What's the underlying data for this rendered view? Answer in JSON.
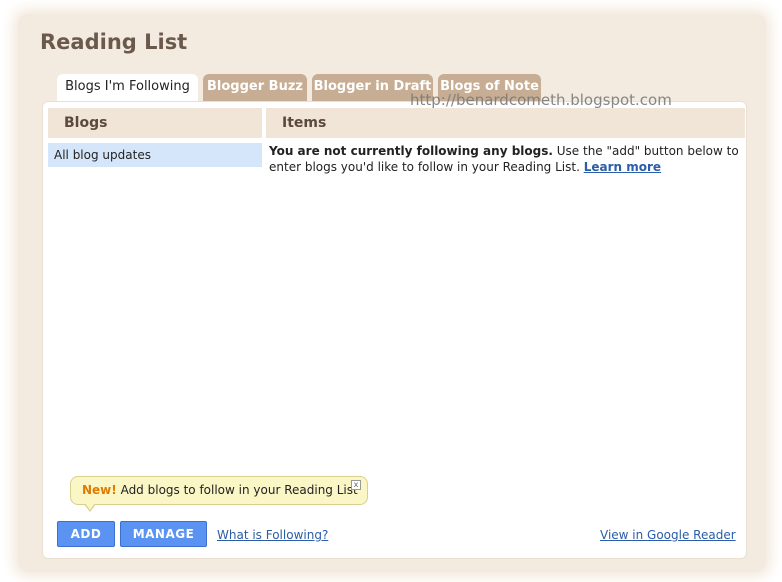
{
  "page": {
    "title": "Reading List"
  },
  "tabs": [
    {
      "label": "Blogs I'm Following",
      "active": true
    },
    {
      "label": "Blogger Buzz",
      "active": false
    },
    {
      "label": "Blogger in Draft",
      "active": false
    },
    {
      "label": "Blogs of Note",
      "active": false
    }
  ],
  "watermark": "http://benardcometh.blogspot.com",
  "columns": {
    "blogs": "Blogs",
    "items": "Items"
  },
  "blogs_list": [
    "All blog updates"
  ],
  "items_message": {
    "bold": "You are not currently following any blogs.",
    "text": " Use the \"add\" button below to enter blogs you'd like to follow in your Reading List. ",
    "link": "Learn more"
  },
  "tooltip": {
    "new_label": "New!",
    "text": " Add blogs to follow in your Reading List",
    "close": "x"
  },
  "buttons": {
    "add": "ADD",
    "manage": "MANAGE"
  },
  "links": {
    "what_is_following": "What is Following?",
    "view_in_reader": "View in Google Reader"
  },
  "colors": {
    "accent_blue": "#5b93f2",
    "tab_tan": "#c7ad93",
    "frame_bg": "#f4ebe0",
    "link": "#2b5da8"
  }
}
